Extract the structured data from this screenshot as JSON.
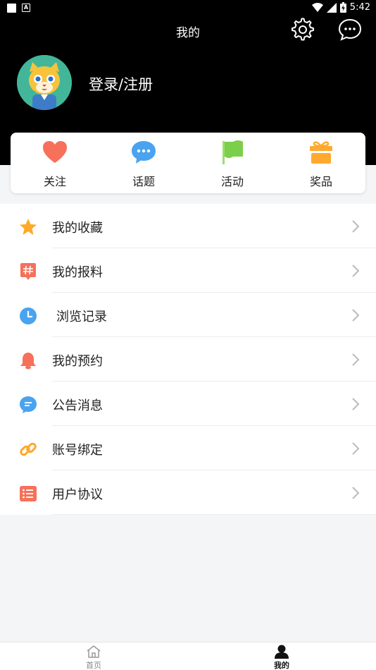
{
  "status_bar": {
    "time": "5:42"
  },
  "header": {
    "title": "我的",
    "login_text": "登录/注册",
    "settings_icon": "gear-icon",
    "message_icon": "chat-bubble-icon"
  },
  "quick_actions": [
    {
      "label": "关注",
      "icon": "heart-icon",
      "color": "#f7705a"
    },
    {
      "label": "话题",
      "icon": "chat-bubble-icon",
      "color": "#4aa3f0"
    },
    {
      "label": "活动",
      "icon": "flag-icon",
      "color": "#7ccf4a"
    },
    {
      "label": "奖品",
      "icon": "gift-icon",
      "color": "#ffaa2e"
    }
  ],
  "menu": [
    {
      "label": "我的收藏",
      "icon": "star-icon",
      "color": "#ffa928"
    },
    {
      "label": "我的报料",
      "icon": "hashtag-icon",
      "color": "#f7705a"
    },
    {
      "label": "浏览记录",
      "icon": "clock-icon",
      "color": "#4aa3f0"
    },
    {
      "label": "我的预约",
      "icon": "bell-icon",
      "color": "#f7705a"
    },
    {
      "label": "公告消息",
      "icon": "message-icon",
      "color": "#4aa3f0"
    },
    {
      "label": "账号绑定",
      "icon": "link-icon",
      "color": "#ffa928"
    },
    {
      "label": "用户协议",
      "icon": "list-icon",
      "color": "#f7705a"
    }
  ],
  "bottom_nav": [
    {
      "label": "首页",
      "icon": "home-icon",
      "active": false
    },
    {
      "label": "我的",
      "icon": "person-icon",
      "active": true
    }
  ]
}
